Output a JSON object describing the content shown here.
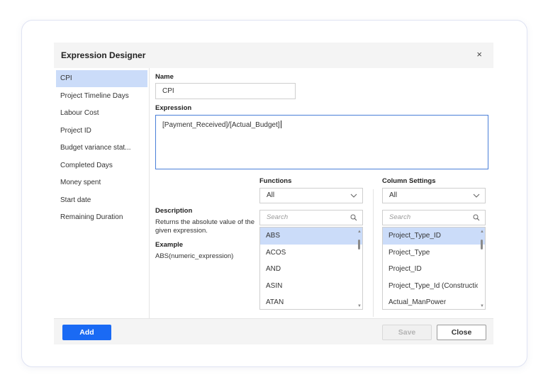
{
  "dialog": {
    "title": "Expression Designer",
    "close_glyph": "×"
  },
  "sidebar": {
    "items": [
      {
        "label": "CPI",
        "selected": true
      },
      {
        "label": "Project Timeline Days"
      },
      {
        "label": "Labour Cost"
      },
      {
        "label": "Project ID"
      },
      {
        "label": "Budget variance stat..."
      },
      {
        "label": "Completed Days"
      },
      {
        "label": "Money spent"
      },
      {
        "label": "Start date"
      },
      {
        "label": "Remaining Duration"
      }
    ]
  },
  "name": {
    "label": "Name",
    "value": "CPI"
  },
  "expression": {
    "label": "Expression",
    "value": "[Payment_Received]/[Actual_Budget]"
  },
  "functions": {
    "label": "Functions",
    "filter_value": "All",
    "search_placeholder": "Search",
    "items": [
      "ABS",
      "ACOS",
      "AND",
      "ASIN",
      "ATAN"
    ],
    "selected": "ABS"
  },
  "columns": {
    "label": "Column Settings",
    "filter_value": "All",
    "search_placeholder": "Search",
    "items": [
      "Project_Type_ID",
      "Project_Type",
      "Project_ID",
      "Project_Type_Id (Constructio...",
      "Actual_ManPower"
    ],
    "selected": "Project_Type_ID"
  },
  "description": {
    "label": "Description",
    "text": "Returns the absolute value of the given expression.",
    "example_label": "Example",
    "example_text": "ABS(numeric_expression)"
  },
  "footer": {
    "add_label": "Add",
    "save_label": "Save",
    "close_label": "Close"
  },
  "icons": {
    "search": "search-icon",
    "dropdown": "chevron-down-icon",
    "close": "close-icon"
  },
  "colors": {
    "accent": "#1a6af4",
    "selection": "#cbdcf9",
    "focus_border": "#4a7fd8"
  }
}
